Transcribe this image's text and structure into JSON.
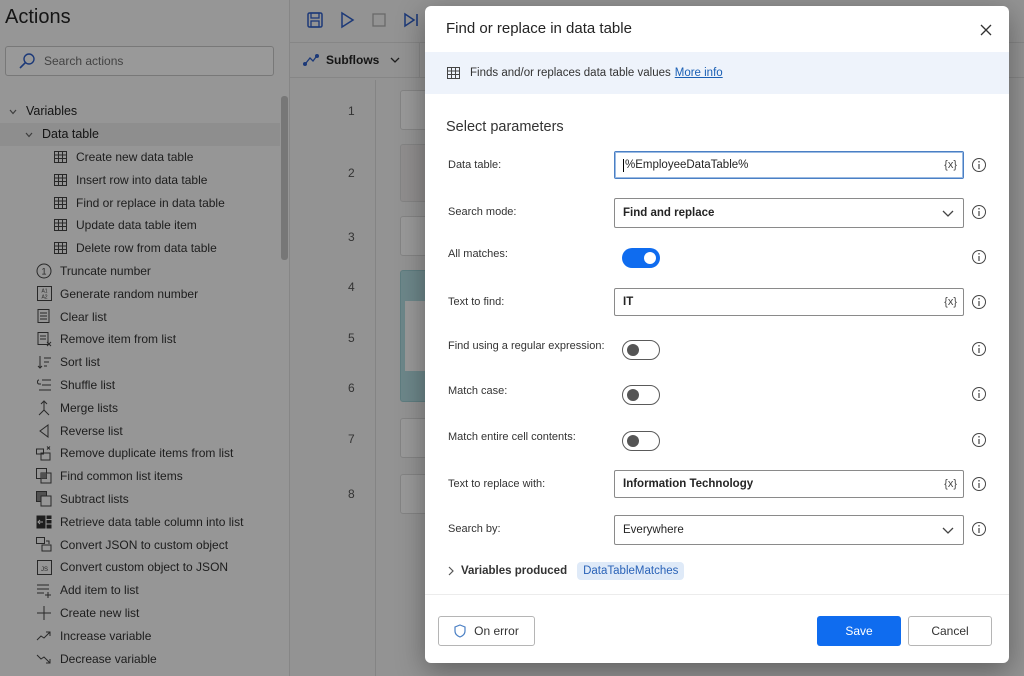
{
  "actions_pane": {
    "title": "Actions",
    "search_placeholder": "Search actions",
    "tree": [
      {
        "label": "Variables",
        "level": "group",
        "icon": "chevron-down-icon"
      },
      {
        "label": "Data table",
        "level": "subgroup",
        "icon": "chevron-down-icon"
      },
      {
        "label": "Create new data table",
        "level": "item2",
        "icon": "table-icon"
      },
      {
        "label": "Insert row into data table",
        "level": "item2",
        "icon": "table-icon"
      },
      {
        "label": "Find or replace in data table",
        "level": "item2",
        "icon": "table-icon"
      },
      {
        "label": "Update data table item",
        "level": "item2",
        "icon": "table-icon"
      },
      {
        "label": "Delete row from data table",
        "level": "item2",
        "icon": "table-icon"
      },
      {
        "label": "Truncate number",
        "level": "item",
        "icon": "number-circle-icon"
      },
      {
        "label": "Generate random number",
        "level": "item",
        "icon": "random-number-icon"
      },
      {
        "label": "Clear list",
        "level": "item",
        "icon": "clear-list-icon"
      },
      {
        "label": "Remove item from list",
        "level": "item",
        "icon": "remove-item-icon"
      },
      {
        "label": "Sort list",
        "level": "item",
        "icon": "sort-icon"
      },
      {
        "label": "Shuffle list",
        "level": "item",
        "icon": "shuffle-icon"
      },
      {
        "label": "Merge lists",
        "level": "item",
        "icon": "merge-icon"
      },
      {
        "label": "Reverse list",
        "level": "item",
        "icon": "reverse-icon"
      },
      {
        "label": "Remove duplicate items from list",
        "level": "item",
        "icon": "remove-duplicates-icon"
      },
      {
        "label": "Find common list items",
        "level": "item",
        "icon": "common-items-icon"
      },
      {
        "label": "Subtract lists",
        "level": "item",
        "icon": "subtract-icon"
      },
      {
        "label": "Retrieve data table column into list",
        "level": "item",
        "icon": "retrieve-column-icon"
      },
      {
        "label": "Convert JSON to custom object",
        "level": "item",
        "icon": "json-to-object-icon"
      },
      {
        "label": "Convert custom object to JSON",
        "level": "item",
        "icon": "object-to-json-icon"
      },
      {
        "label": "Add item to list",
        "level": "item",
        "icon": "add-item-icon"
      },
      {
        "label": "Create new list",
        "level": "item",
        "icon": "plus-icon"
      },
      {
        "label": "Increase variable",
        "level": "item",
        "icon": "trend-up-icon"
      },
      {
        "label": "Decrease variable",
        "level": "item",
        "icon": "trend-down-icon"
      }
    ]
  },
  "designer": {
    "subflows_label": "Subflows",
    "line_numbers": [
      "1",
      "2",
      "3",
      "4",
      "5",
      "6",
      "7",
      "8"
    ]
  },
  "dialog": {
    "title": "Find or replace in data table",
    "description": "Finds and/or replaces data table values",
    "more_info": "More info",
    "section_title": "Select parameters",
    "params": {
      "data_table": {
        "label": "Data table:",
        "value": "%EmployeeDataTable%",
        "var_icon": "{x}"
      },
      "search_mode": {
        "label": "Search mode:",
        "value": "Find and replace"
      },
      "all_matches": {
        "label": "All matches:",
        "on": true
      },
      "text_to_find": {
        "label": "Text to find:",
        "value": "IT",
        "var_icon": "{x}"
      },
      "regex": {
        "label": "Find using a regular expression:",
        "on": false
      },
      "match_case": {
        "label": "Match case:",
        "on": false
      },
      "match_entire": {
        "label": "Match entire cell contents:",
        "on": false
      },
      "replace_with": {
        "label": "Text to replace with:",
        "value": "Information Technology",
        "var_icon": "{x}"
      },
      "search_by": {
        "label": "Search by:",
        "value": "Everywhere"
      }
    },
    "variables_produced_label": "Variables produced",
    "variables_produced": [
      "DataTableMatches"
    ],
    "buttons": {
      "on_error": "On error",
      "save": "Save",
      "cancel": "Cancel"
    },
    "colors": {
      "accent": "#0f6cef",
      "info_bg": "#eef3fb",
      "chip_bg": "#dfeaf8",
      "chip_text": "#2a63b8"
    }
  }
}
